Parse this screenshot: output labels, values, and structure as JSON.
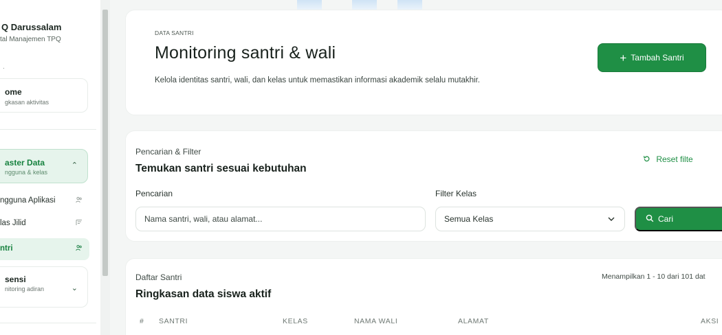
{
  "sidebar": {
    "brand_name": "Q Darussalam",
    "brand_sub": "tal Manajemen TPQ",
    "dot": ".",
    "home": {
      "title": "ome",
      "sub": "gkasan aktivitas"
    },
    "master": {
      "title": "aster Data",
      "sub": "ngguna & kelas",
      "chevron": "⌃"
    },
    "items": [
      {
        "label": "ngguna Aplikasi",
        "icon": "users-icon"
      },
      {
        "label": "las Jilid",
        "icon": "book-icon"
      },
      {
        "label": "ntri",
        "icon": "users-icon"
      }
    ],
    "absensi": {
      "title": "sensi",
      "sub": "nitoring adiran",
      "chevron": "⌄"
    }
  },
  "header": {
    "eyebrow": "DATA SANTRI",
    "title": "Monitoring santri & wali",
    "description": "Kelola identitas santri, wali, dan kelas untuk memastikan informasi akademik selalu mutakhir.",
    "add_button": "Tambah Santri"
  },
  "filter": {
    "eyebrow": "Pencarian & Filter",
    "title": "Temukan santri sesuai kebutuhan",
    "reset_label": "Reset filte",
    "search_label": "Pencarian",
    "search_placeholder": "Nama santri, wali, atau alamat...",
    "kelas_label": "Filter Kelas",
    "kelas_value": "Semua Kelas",
    "search_button": "Cari"
  },
  "list": {
    "eyebrow": "Daftar Santri",
    "title": "Ringkasan data siswa aktif",
    "count": "Menampilkan 1 - 10 dari 101 dat",
    "columns": [
      "#",
      "SANTRI",
      "KELAS",
      "NAMA WALI",
      "ALAMAT",
      "AKSI"
    ]
  },
  "colors": {
    "accent": "#1f8f45",
    "accent_soft": "#e6f4ec"
  }
}
